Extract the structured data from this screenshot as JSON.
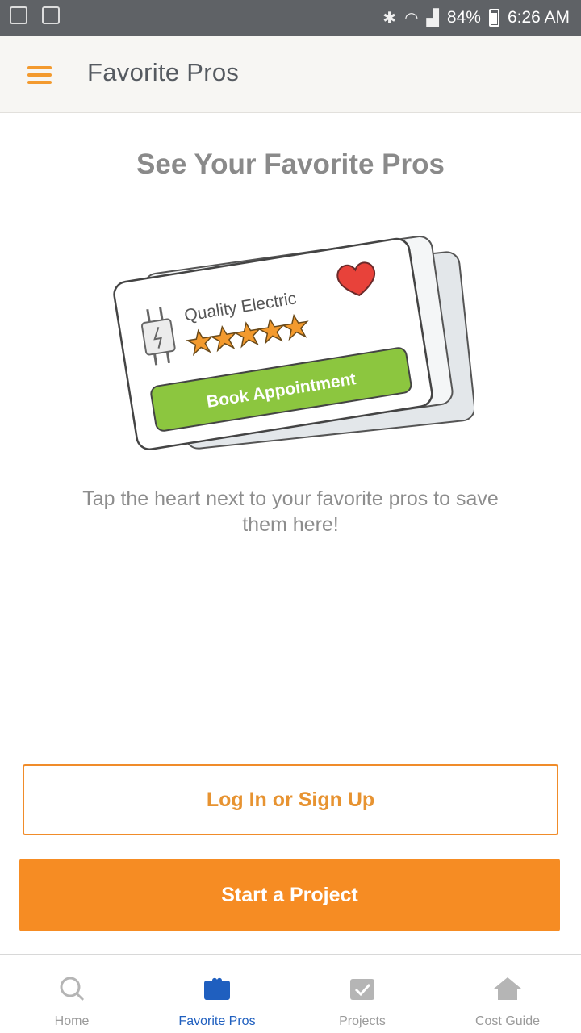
{
  "status_bar": {
    "battery": "84%",
    "time": "6:26 AM"
  },
  "header": {
    "title": "Favorite Pros",
    "menu_icon": "hamburger-menu-icon"
  },
  "main": {
    "section_title": "See Your Favorite Pros",
    "illustration": {
      "card_name": "Quality Electric",
      "rating_stars": 5,
      "card_button": "Book Appointment"
    },
    "empty_message": "Tap the heart next to your favorite pros to save them here!"
  },
  "actions": {
    "login_label": "Log In or Sign Up",
    "start_label": "Start a Project"
  },
  "bottom_nav": {
    "items": [
      {
        "label": "Home",
        "icon": "home-search-icon"
      },
      {
        "label": "Favorite Pros",
        "icon": "favorite-pros-icon"
      },
      {
        "label": "Projects",
        "icon": "projects-check-icon"
      },
      {
        "label": "Cost Guide",
        "icon": "cost-guide-house-icon"
      }
    ],
    "active": "Favorite Pros"
  },
  "colors": {
    "accent": "#f68c23",
    "active_nav": "#1f5fbf",
    "card_button": "#8cc63f",
    "heart": "#e8423a"
  }
}
